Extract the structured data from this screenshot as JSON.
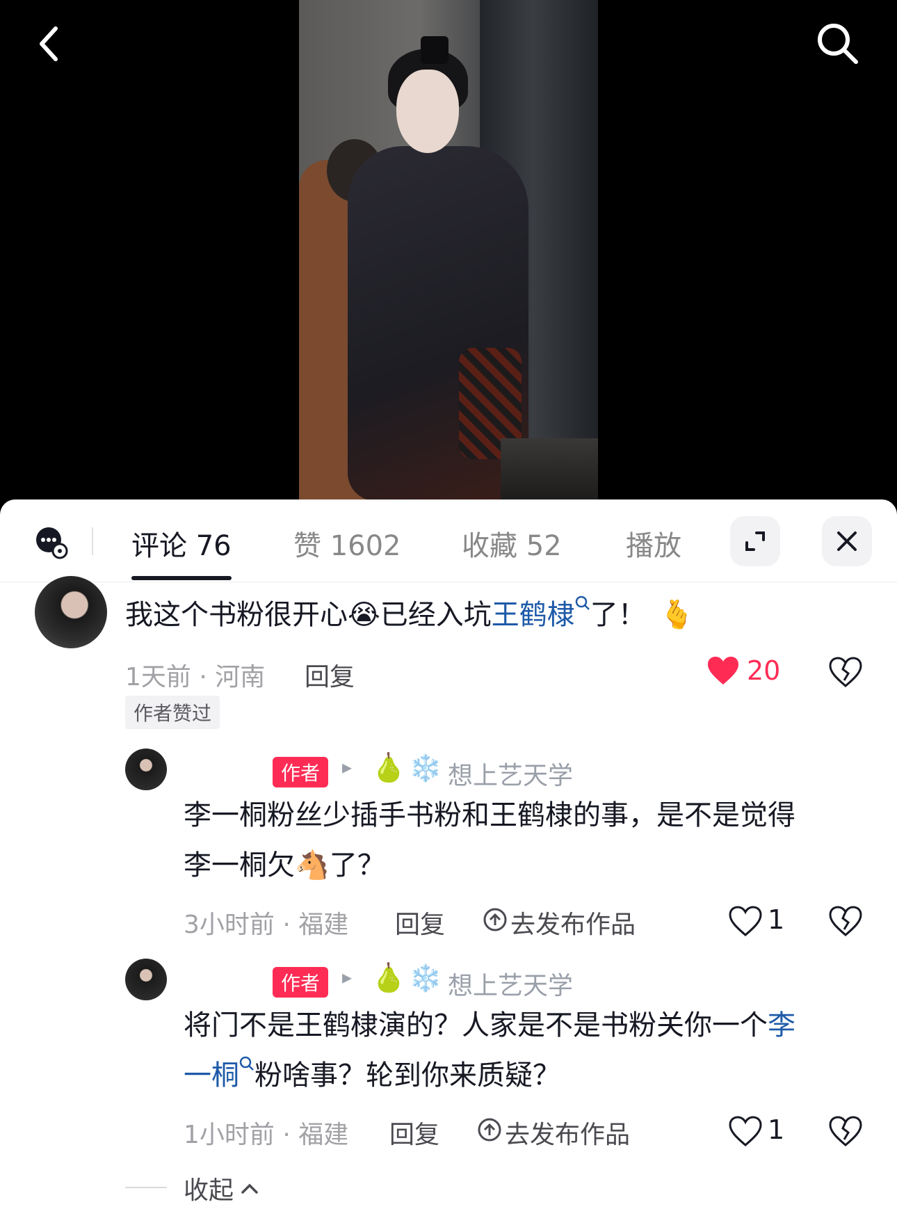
{
  "tabs": {
    "comments": "评论 76",
    "likes": "赞 1602",
    "favorites": "收藏 52",
    "plays": "播放"
  },
  "comment1": {
    "text_a": "我这个书粉很开心",
    "emoji_a": "😭",
    "text_b": "已经入坑",
    "mention": "王鹤棣",
    "text_c": "了！",
    "emoji_b": "🫰",
    "meta": "1天前 · 河南",
    "reply": "回复",
    "likes": "20",
    "author_liked": "作者赞过"
  },
  "reply1": {
    "author_badge": "作者",
    "arrow": "▸",
    "pear": "🍐",
    "snow": "❄️",
    "target_name": "想上艺天学",
    "text_line1": "李一桐粉丝少插手书粉和王鹤棣的事，是不是觉得",
    "text_line2_a": "李一桐欠",
    "horse": "🐴",
    "text_line2_b": "了？",
    "meta": "3小时前 · 福建",
    "reply": "回复",
    "publish": "去发布作品",
    "likes": "1"
  },
  "reply2": {
    "author_badge": "作者",
    "arrow": "▸",
    "pear": "🍐",
    "snow": "❄️",
    "target_name": "想上艺天学",
    "text_line1_a": "将门不是王鹤棣演的？人家是不是书粉关你一个",
    "mention_a": "李",
    "mention_b": "一桐",
    "text_line2_b": "粉啥事？轮到你来质疑？",
    "meta": "1小时前 · 福建",
    "reply": "回复",
    "publish": "去发布作品",
    "likes": "1"
  },
  "collapse": "收起",
  "colors": {
    "accent_red": "#fe2c55",
    "link_blue": "#1e5aa8",
    "text_dark": "#161823",
    "meta_gray": "#a1a1a6"
  }
}
